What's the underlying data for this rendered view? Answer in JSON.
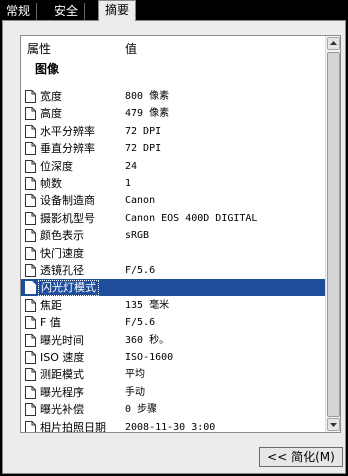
{
  "tabs": [
    {
      "label": "常规"
    },
    {
      "label": "安全"
    },
    {
      "label": "摘要"
    }
  ],
  "list": {
    "header": {
      "property": "属性",
      "value": "值"
    },
    "group_label": "图像",
    "rows": [
      {
        "name": "宽度",
        "value": "800 像素"
      },
      {
        "name": "高度",
        "value": "479 像素"
      },
      {
        "name": "水平分辨率",
        "value": "72 DPI"
      },
      {
        "name": "垂直分辨率",
        "value": "72 DPI"
      },
      {
        "name": "位深度",
        "value": "24"
      },
      {
        "name": "帧数",
        "value": "1"
      },
      {
        "name": "设备制造商",
        "value": "Canon"
      },
      {
        "name": "摄影机型号",
        "value": "Canon EOS 400D DIGITAL"
      },
      {
        "name": "颜色表示",
        "value": "sRGB"
      },
      {
        "name": "快门速度",
        "value": ""
      },
      {
        "name": "透镜孔径",
        "value": "F/5.6"
      },
      {
        "name": "闪光灯模式",
        "value": "",
        "selected": true
      },
      {
        "name": "焦距",
        "value": "135 毫米"
      },
      {
        "name": "F 值",
        "value": "F/5.6"
      },
      {
        "name": "曝光时间",
        "value": "360 秒。"
      },
      {
        "name": "ISO 速度",
        "value": "ISO-1600"
      },
      {
        "name": "测距模式",
        "value": "平均"
      },
      {
        "name": "曝光程序",
        "value": "手动"
      },
      {
        "name": "曝光补偿",
        "value": "0 步骤"
      },
      {
        "name": "相片拍照日期",
        "value": "2008-11-30 3:00"
      }
    ]
  },
  "buttons": {
    "simple": "<< 简化(M)"
  },
  "icons": {
    "row": "document-icon"
  },
  "colors": {
    "selection": "#1f4f9c"
  }
}
